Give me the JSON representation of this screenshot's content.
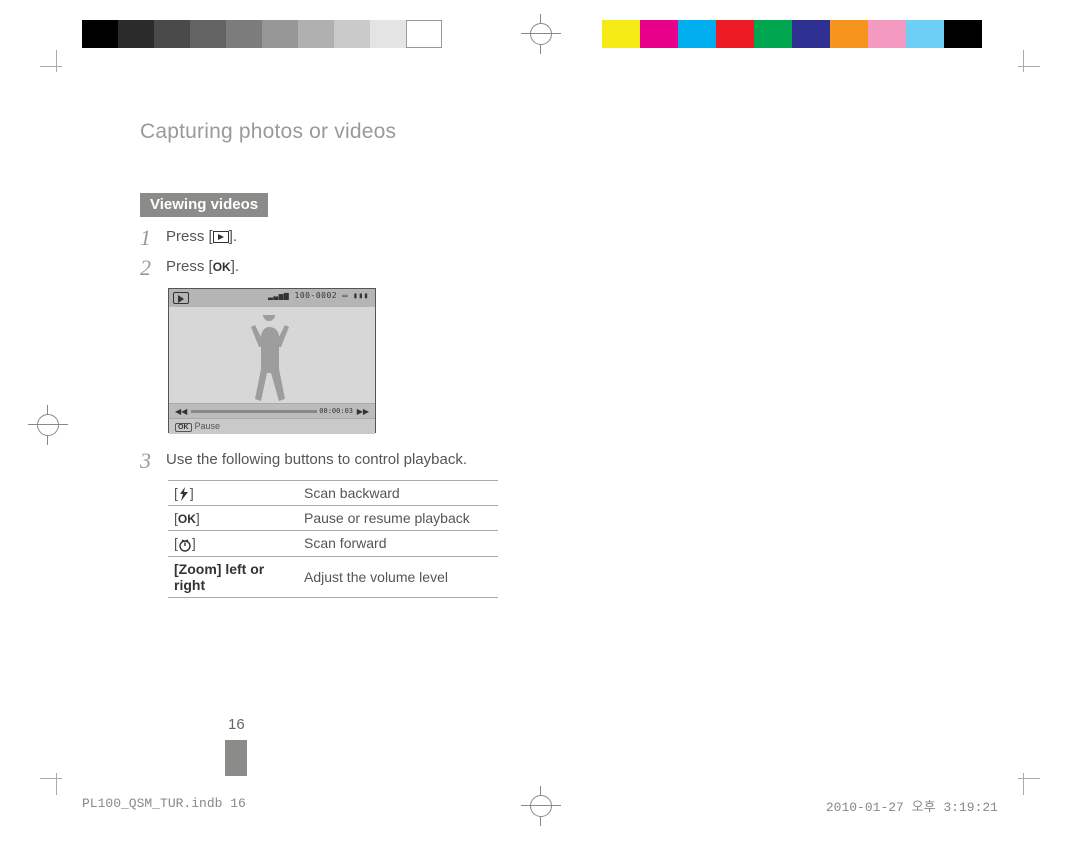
{
  "title": "Capturing photos or videos",
  "section_label": "Viewing videos",
  "steps": {
    "s1_prefix": "Press [",
    "s1_suffix": "].",
    "s2_prefix": "Press [",
    "s2_suffix": "].",
    "s3": "Use the following buttons to control playback."
  },
  "screen": {
    "meta": "100-0002",
    "time": "00:00:03",
    "hint_label": "Pause"
  },
  "controls": [
    {
      "key_type": "flash",
      "key_text": "",
      "desc": "Scan backward"
    },
    {
      "key_type": "ok",
      "key_text": "OK",
      "desc": "Pause or resume playback"
    },
    {
      "key_type": "timer",
      "key_text": "",
      "desc": "Scan forward"
    },
    {
      "key_type": "zoom",
      "key_text": "[Zoom] left or right",
      "desc": "Adjust the volume level"
    }
  ],
  "page_number": "16",
  "footer_left": "PL100_QSM_TUR.indb   16",
  "footer_right": "2010-01-27   오후 3:19:21",
  "colorbar_left": [
    "#000000",
    "#2b2b2b",
    "#4a4a4a",
    "#636363",
    "#7c7c7c",
    "#969696",
    "#b0b0b0",
    "#cacaca",
    "#e4e4e4",
    "#ffffff"
  ],
  "colorbar_right": [
    "#f5ea14",
    "#e9008a",
    "#00adee",
    "#ed1c24",
    "#00a650",
    "#2e3192",
    "#f7941d",
    "#f49ac1",
    "#6dcff6",
    "#000000"
  ]
}
